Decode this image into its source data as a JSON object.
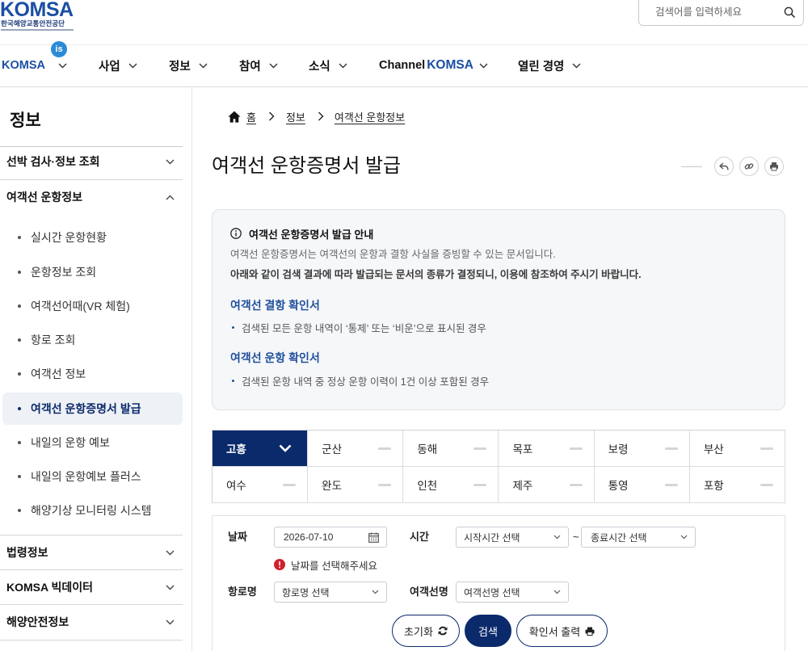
{
  "header": {
    "logo_text": "KOMSA",
    "logo_subtitle": "한국해양교통안전공단",
    "search_placeholder": "검색어를 입력하세요",
    "search_icon": "search-icon"
  },
  "nav": {
    "badge": "is",
    "items": [
      {
        "label": "KOMSA"
      },
      {
        "label": "사업"
      },
      {
        "label": "정보"
      },
      {
        "label": "참여"
      },
      {
        "label": "소식"
      },
      {
        "label": "Channel",
        "brand": "KOMSA"
      },
      {
        "label": "열린 경영"
      }
    ]
  },
  "sidebar": {
    "title": "정보",
    "groups": [
      {
        "label": "선박 검사·정보 조회",
        "expanded": false
      },
      {
        "label": "여객선 운항정보",
        "expanded": true,
        "items": [
          {
            "label": "실시간 운항현황"
          },
          {
            "label": "운항정보 조회"
          },
          {
            "label": "여객선어때(VR 체험)"
          },
          {
            "label": "항로 조회"
          },
          {
            "label": "여객선 정보"
          },
          {
            "label": "여객선 운항증명서 발급",
            "active": true
          },
          {
            "label": "내일의 운항 예보"
          },
          {
            "label": "내일의 운항예보 플러스"
          },
          {
            "label": "해양기상 모니터링 시스템"
          }
        ]
      },
      {
        "label": "법령정보",
        "expanded": false
      },
      {
        "label": "KOMSA 빅데이터",
        "expanded": false
      },
      {
        "label": "해양안전정보",
        "expanded": false
      }
    ]
  },
  "breadcrumb": [
    "홈",
    "정보",
    "여객선 운항정보"
  ],
  "page_title": "여객선 운항증명서 발급",
  "page_actions": [
    "share-icon",
    "link-icon",
    "print-icon"
  ],
  "notice": {
    "heading": "여객선 운항증명서 발급 안내",
    "lines": [
      "여객선 운항증명서는 여객선의 운항과 결항 사실을 증빙할 수 있는 문서입니다.",
      "아래와 같이 검색 결과에 따라 발급되는 문서의 종류가 결정되니, 이용에 참조하여 주시기 바랍니다."
    ],
    "sections": [
      {
        "title": "여객선 결항 확인서",
        "bullet": "검색된 모든 운항 내역이 ‘통제’ 또는 ‘비운’으로 표시된 경우"
      },
      {
        "title": "여객선 운항 확인서",
        "bullet": "검색된 운항 내역 중 정상 운항 이력이 1건 이상 포함된 경우"
      }
    ]
  },
  "region_tabs": {
    "selected": "고흥",
    "items": [
      "고흥",
      "군산",
      "동해",
      "목포",
      "보령",
      "부산",
      "여수",
      "완도",
      "인천",
      "제주",
      "통영",
      "포항"
    ]
  },
  "search_form": {
    "date_label": "날짜",
    "date_value": "2026-07-10",
    "time_label": "시간",
    "start_time": "시작시간 선택",
    "time_separator": "~",
    "end_time": "종료시간 선택",
    "date_error": "날짜를 선택해주세요",
    "route_label": "항로명",
    "route_value": "항로명 선택",
    "ship_label": "여객선명",
    "ship_value": "여객선명 선택",
    "reset_button": "초기화",
    "search_button": "검색",
    "print_button": "확인서 출력"
  },
  "colors": {
    "brand": "#1b4fa3",
    "navy": "#0b2a6b",
    "badge": "#2b8bd6",
    "error": "#d0202e",
    "active_menu_bg": "#eef1f6",
    "notice_bg": "#f6f7f9"
  }
}
